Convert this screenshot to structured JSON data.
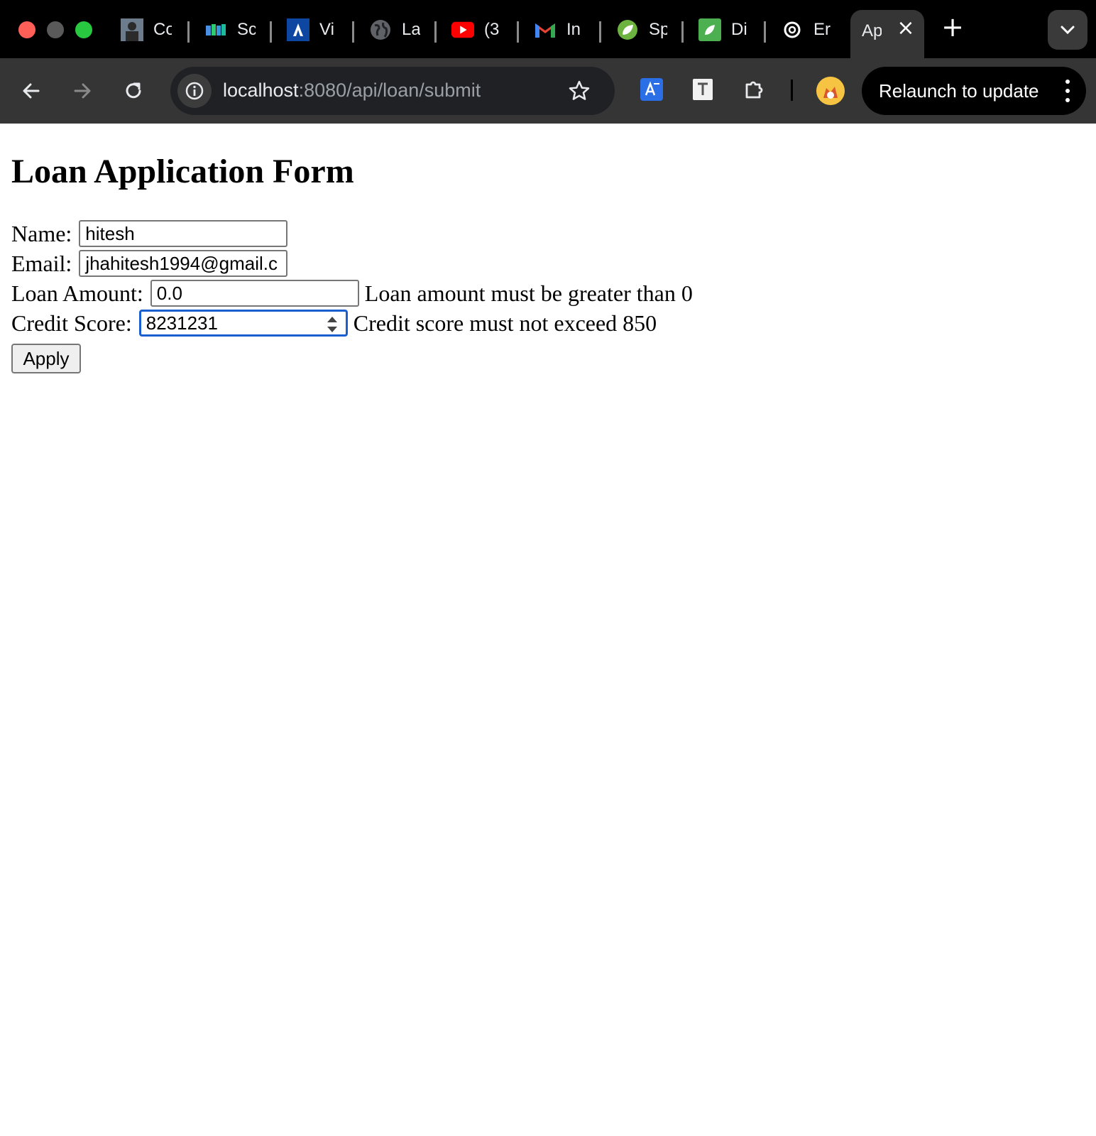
{
  "browser": {
    "tabs": [
      {
        "title": "Co",
        "icon": "profile-photo-icon"
      },
      {
        "title": "Sc",
        "icon": "books-icon"
      },
      {
        "title": "Vi",
        "icon": "a-logo-icon"
      },
      {
        "title": "La",
        "icon": "globe-icon"
      },
      {
        "title": "(3",
        "icon": "youtube-icon"
      },
      {
        "title": "In",
        "icon": "gmail-icon"
      },
      {
        "title": "Sp",
        "icon": "spring-icon"
      },
      {
        "title": "Di",
        "icon": "leaf-icon"
      },
      {
        "title": "Er",
        "icon": "openai-icon"
      }
    ],
    "active_tab": {
      "title": "Ap"
    },
    "url_host": "localhost",
    "url_rest": ":8080/api/loan/submit",
    "relaunch_label": "Relaunch to update"
  },
  "form": {
    "heading": "Loan Application Form",
    "name_label": "Name:",
    "name_value": "hitesh",
    "email_label": "Email:",
    "email_value": "jhahitesh1994@gmail.c",
    "loan_amount_label": "Loan Amount:",
    "loan_amount_value": "0.0",
    "loan_amount_error": "Loan amount must be greater than 0",
    "credit_score_label": "Credit Score:",
    "credit_score_value": "8231231",
    "credit_score_error": "Credit score must not exceed 850",
    "apply_label": "Apply"
  },
  "colors": {
    "tabstrip": "#000000",
    "toolbar": "#353535",
    "focus_ring": "#1a5fd0"
  }
}
